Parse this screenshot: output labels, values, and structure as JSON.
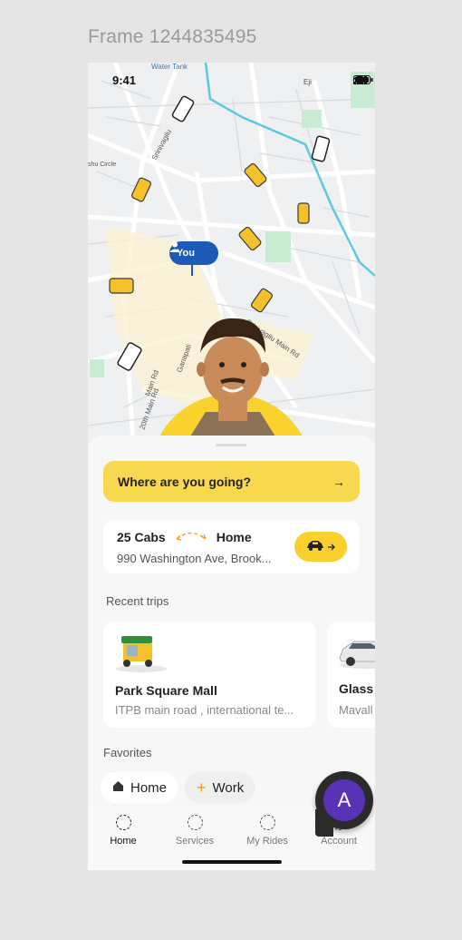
{
  "frame": {
    "label": "Frame 1244835495"
  },
  "status_bar": {
    "time": "9:41",
    "icons": [
      "signal-icon",
      "wifi-icon",
      "battery-icon"
    ]
  },
  "map": {
    "labels": [
      "Water Tank",
      "Srinivagilu",
      "Srinivagilu Main Rd",
      "20th Main Rd",
      "Ganapati",
      "Main Rd",
      "Eji",
      "shu Circle"
    ],
    "you_pin": "You"
  },
  "search": {
    "placeholder": "Where are you going?",
    "arrow": "→"
  },
  "cab_card": {
    "count": "25 Cabs",
    "destination": "Home",
    "address": "990 Washington Ave, Brook...",
    "button_icon": "car-arrow-icon"
  },
  "recent_trips": {
    "title": "Recent trips",
    "items": [
      {
        "name": "Park Square Mall",
        "address": "ITPB main road , international te...",
        "icon": "auto-rickshaw-icon"
      },
      {
        "name": "Glass",
        "address": "Mavall",
        "icon": "car-icon"
      }
    ]
  },
  "favorites": {
    "title": "Favorites",
    "chips": [
      {
        "label": "Home",
        "icon": "house-icon"
      },
      {
        "label": "Work",
        "icon": "plus-icon"
      }
    ]
  },
  "bottom_nav": {
    "items": [
      {
        "label": "Home",
        "active": true
      },
      {
        "label": "Services",
        "active": false
      },
      {
        "label": "My Rides",
        "active": false
      },
      {
        "label": "Account",
        "active": false
      }
    ]
  },
  "fab": {
    "letter": "A"
  },
  "colors": {
    "accent_yellow": "#f8d84e",
    "pin_blue": "#1b5bb7",
    "avatar_purple": "#5a32b8",
    "river": "#5ec8e4"
  }
}
